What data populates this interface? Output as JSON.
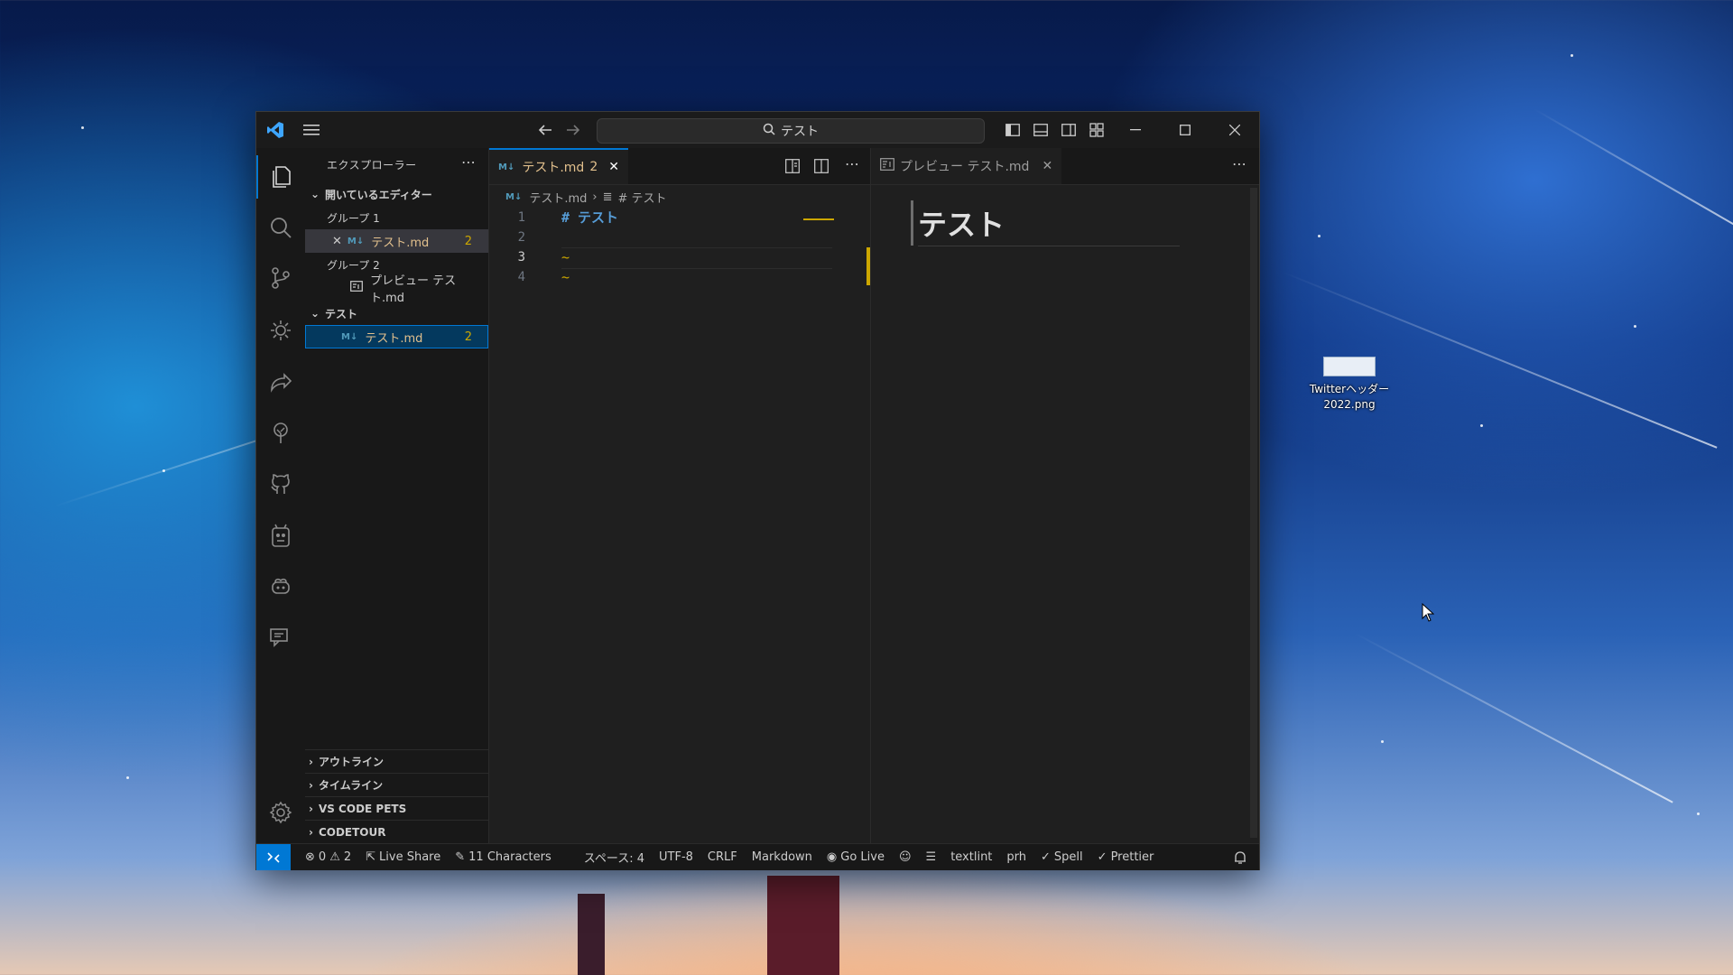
{
  "window": {
    "search_text": "テスト",
    "accent_color": "#0078d4"
  },
  "sidebar": {
    "title": "エクスプローラー",
    "open_editors_label": "開いているエディター",
    "group1_label": "グループ 1",
    "group1_file": "テスト.md",
    "group1_file_badge": "2",
    "group2_label": "グループ 2",
    "group2_file": "プレビュー テスト.md",
    "folder_label": "テスト",
    "folder_file": "テスト.md",
    "folder_file_badge": "2",
    "sections": [
      "アウトライン",
      "タイムライン",
      "VS CODE PETS",
      "CODETOUR"
    ]
  },
  "editor1": {
    "tab_label": "テスト.md",
    "tab_badge": "2",
    "breadcrumb_file": "テスト.md",
    "breadcrumb_symbol": "# テスト",
    "line_numbers": [
      "1",
      "2",
      "3",
      "4"
    ],
    "code_line1": "# テスト",
    "md_icon": "M↓"
  },
  "editor2": {
    "tab_label": "プレビュー テスト.md",
    "heading": "テスト"
  },
  "status": {
    "errors": "0",
    "warnings": "2",
    "live_share": "Live Share",
    "characters": "11 Characters",
    "spaces": "スペース: 4",
    "encoding": "UTF-8",
    "eol": "CRLF",
    "language": "Markdown",
    "go_live": "Go Live",
    "textlint": "textlint",
    "prh": "prh",
    "spell": "Spell",
    "prettier": "Prettier"
  },
  "desktop": {
    "icon_label_line1": "Twitterヘッダー",
    "icon_label_line2": "2022.png"
  }
}
